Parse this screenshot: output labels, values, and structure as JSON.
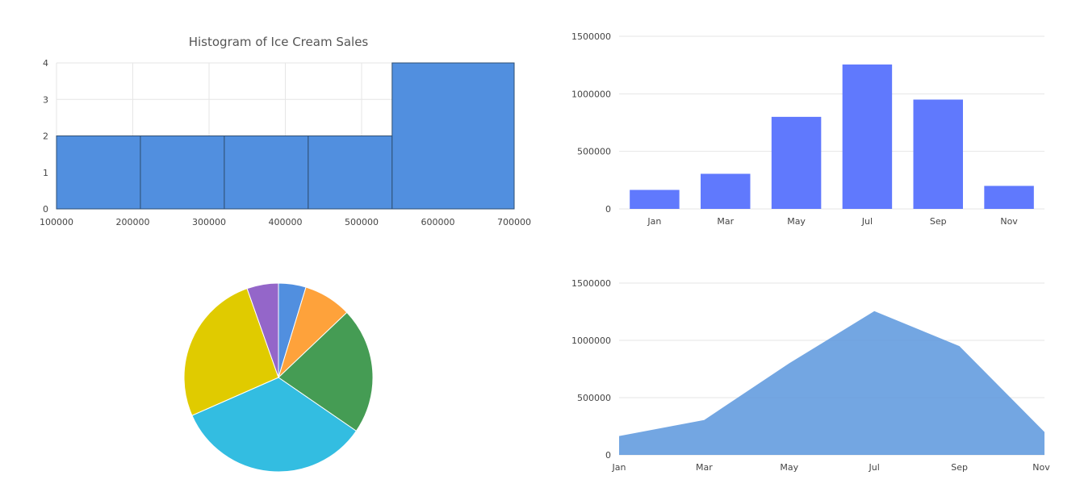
{
  "chart_data": [
    {
      "type": "bar",
      "subtype": "histogram",
      "title": "Histogram of Ice Cream Sales",
      "x_ticks": [
        "100000",
        "200000",
        "300000",
        "400000",
        "500000",
        "600000",
        "700000"
      ],
      "y_ticks": [
        "0",
        "1",
        "2",
        "3",
        "4"
      ],
      "xlim": [
        100000,
        700000
      ],
      "ylim": [
        0,
        4
      ],
      "bins": [
        {
          "from": 100000,
          "to": 210000,
          "count": 2
        },
        {
          "from": 210000,
          "to": 320000,
          "count": 2
        },
        {
          "from": 320000,
          "to": 430000,
          "count": 2
        },
        {
          "from": 430000,
          "to": 540000,
          "count": 2
        },
        {
          "from": 540000,
          "to": 700000,
          "count": 4
        }
      ],
      "color": "#518fdf",
      "grid": true
    },
    {
      "type": "bar",
      "categories": [
        "Jan",
        "Mar",
        "May",
        "Jul",
        "Sep",
        "Nov"
      ],
      "values": [
        165000,
        305000,
        800000,
        1255000,
        950000,
        200000
      ],
      "y_ticks": [
        "0",
        "500000",
        "1000000",
        "1500000"
      ],
      "ylim": [
        0,
        1500000
      ],
      "color": "#6079fd",
      "grid": true
    },
    {
      "type": "pie",
      "values": [
        4.7,
        8.2,
        21.7,
        33.8,
        26.2,
        5.4
      ],
      "colors": [
        "#518fdf",
        "#fea23b",
        "#459c54",
        "#33bde1",
        "#e0cb00",
        "#9466c9"
      ]
    },
    {
      "type": "area",
      "categories": [
        "Jan",
        "Mar",
        "May",
        "Jul",
        "Sep",
        "Nov"
      ],
      "values": [
        165000,
        305000,
        800000,
        1255000,
        950000,
        200000
      ],
      "y_ticks": [
        "0",
        "500000",
        "1000000",
        "1500000"
      ],
      "ylim": [
        0,
        1500000
      ],
      "color": "#5b97dd",
      "grid": true
    }
  ]
}
